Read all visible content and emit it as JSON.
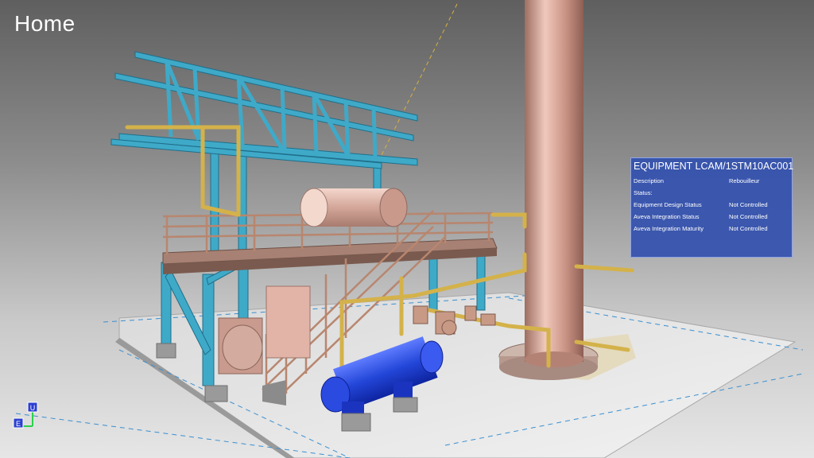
{
  "header": {
    "title": "Home"
  },
  "equipment_panel": {
    "title": "EQUIPMENT LCAM/1STM10AC001",
    "rows": [
      {
        "label": "Description",
        "value": "Rebouilleur"
      },
      {
        "label": "Status:",
        "value": ""
      },
      {
        "label": "Equipment Design Status",
        "value": "Not Controlled"
      },
      {
        "label": "Aveva Integration Status",
        "value": "Not Controlled"
      },
      {
        "label": "Aveva Integration Maturity",
        "value": "Not Controlled"
      }
    ]
  },
  "axis_widget": {
    "up_label": "U",
    "east_label": "E"
  },
  "colors": {
    "structure_steel": "#3fa9c8",
    "piping": "#d4b24a",
    "column_copper": "#c9968a",
    "heat_exchanger": "#2346d8",
    "panel_background": "#3250af"
  }
}
